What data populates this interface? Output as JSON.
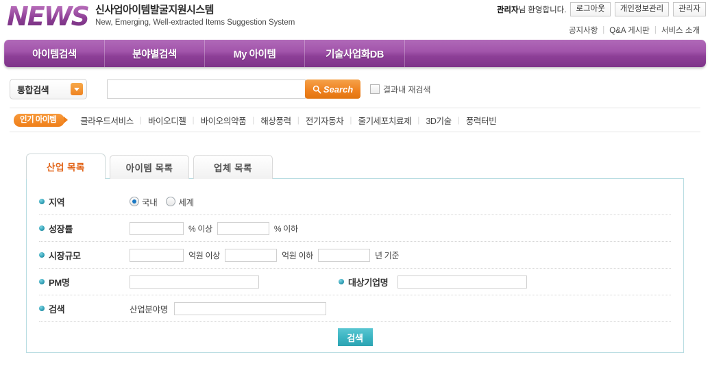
{
  "brand": {
    "logo": "NEWS",
    "title_kr": "신사업아이템발굴지원시스템",
    "title_en": "New, Emerging, Well-extracted Items Suggestion System"
  },
  "topbar": {
    "welcome_user": "관리자",
    "welcome_suffix": "님 환영합니다.",
    "buttons": [
      {
        "label": "로그아웃",
        "name": "logout-button"
      },
      {
        "label": "개인정보관리",
        "name": "privacy-management-button"
      },
      {
        "label": "관리자",
        "name": "admin-button"
      }
    ],
    "links": [
      {
        "label": "공지사항"
      },
      {
        "label": "Q&A 게시판"
      },
      {
        "label": "서비스 소개"
      }
    ],
    "separator": "|"
  },
  "nav": {
    "items": [
      {
        "label": "아이템검색"
      },
      {
        "label": "분야별검색"
      },
      {
        "label": "My 아이템"
      },
      {
        "label": "기술사업화DB"
      }
    ]
  },
  "search": {
    "category_selected": "통합검색",
    "input_value": "",
    "input_placeholder": "",
    "button_label": "Search",
    "recheck_label": "결과내 재검색",
    "recheck_checked": false
  },
  "popular": {
    "badge": "인기 아이템",
    "keywords": [
      "클라우드서비스",
      "바이오디젤",
      "바이오의약품",
      "해상풍력",
      "전기자동차",
      "줄기세포치료제",
      "3D기술",
      "풍력터빈"
    ],
    "divider": "|"
  },
  "tabs": [
    {
      "label": "산업 목록",
      "active": true
    },
    {
      "label": "아이템 목록",
      "active": false
    },
    {
      "label": "업체 목록",
      "active": false
    }
  ],
  "form": {
    "region": {
      "label": "지역",
      "options": [
        {
          "label": "국내",
          "selected": true
        },
        {
          "label": "세계",
          "selected": false
        }
      ]
    },
    "growth": {
      "label": "성장률",
      "min_value": "",
      "min_unit": "% 이상",
      "max_value": "",
      "max_unit": "% 이하"
    },
    "market_size": {
      "label": "시장규모",
      "min_value": "",
      "min_unit": "억원 이상",
      "max_value": "",
      "max_unit": "억원 이하",
      "year_value": "",
      "year_unit": "년 기준"
    },
    "pm": {
      "label": "PM명",
      "value": ""
    },
    "company": {
      "label": "대상기업명",
      "value": ""
    },
    "keyword": {
      "label": "검색",
      "sub_label": "산업분야명",
      "value": ""
    },
    "submit_label": "검색"
  },
  "colors": {
    "nav_purple": "#8d3f97",
    "accent_orange": "#ef8321",
    "submit_teal": "#39b3c1",
    "tab_active_text": "#e2661b",
    "panel_border": "#b9dde2"
  }
}
